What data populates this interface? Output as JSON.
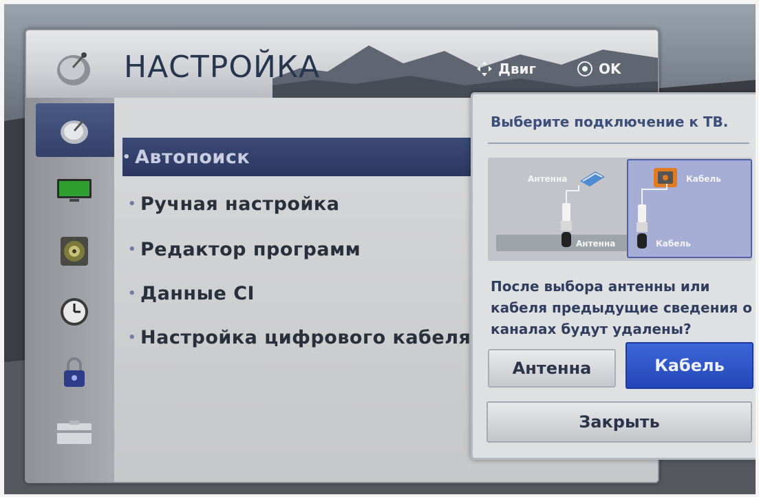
{
  "header": {
    "title": "НАСТРОЙКА",
    "hint_nav_label": "Двиг",
    "hint_ok_label": "OK"
  },
  "sidebar": {
    "items": [
      {
        "icon": "satellite-dish-icon",
        "active": true
      },
      {
        "icon": "tv-screen-icon"
      },
      {
        "icon": "speaker-icon"
      },
      {
        "icon": "clock-icon"
      },
      {
        "icon": "lock-icon"
      },
      {
        "icon": "options-icon"
      }
    ]
  },
  "menu": {
    "items": [
      {
        "label": "Автопоиск",
        "selected": true
      },
      {
        "label": "Ручная настройка"
      },
      {
        "label": "Редактор программ"
      },
      {
        "label": "Данные CI"
      },
      {
        "label": "Настройка цифрового кабеля"
      }
    ]
  },
  "dialog": {
    "title": "Выберите подключение к ТВ.",
    "illustration": {
      "antenna_label_top": "Антенна",
      "antenna_label_bottom": "Антенна",
      "cable_label_top": "Кабель",
      "cable_label_bottom": "Кабель",
      "selected": "Кабель"
    },
    "message": "После выбора антенны или кабеля предыдущие сведения о каналах будут удалены?",
    "buttons": {
      "antenna": "Антенна",
      "cable": "Кабель",
      "close": "Закрыть"
    }
  },
  "colors": {
    "accent": "#2a4cbf",
    "selected_row": "#33416a",
    "title_text": "#26364f"
  }
}
